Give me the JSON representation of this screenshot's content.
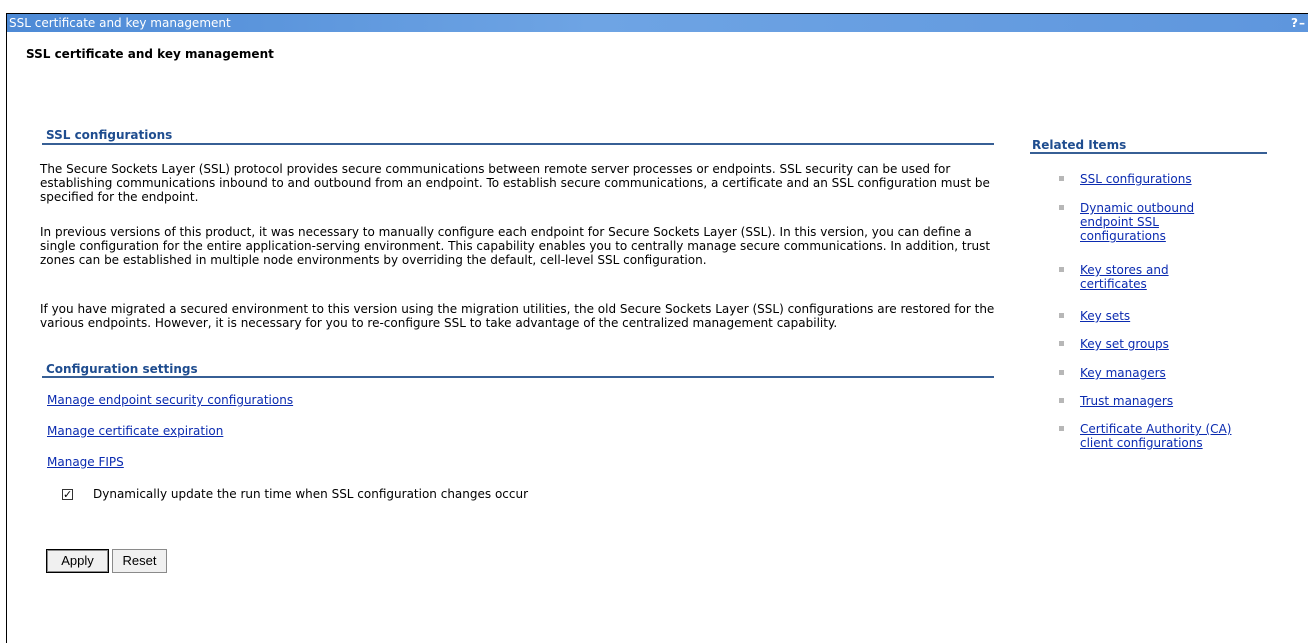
{
  "window": {
    "title": "SSL certificate and key management",
    "help_glyph": "?",
    "minimize_glyph": "–"
  },
  "page": {
    "title": "SSL certificate and key management"
  },
  "ssl_configurations": {
    "heading": "SSL configurations",
    "paragraphs": [
      "The Secure Sockets Layer (SSL) protocol provides secure communications between remote server processes or endpoints. SSL security can be used for establishing communications inbound to and outbound from an endpoint. To establish secure communications, a certificate and an SSL configuration must be specified for the endpoint.",
      "In previous versions of this product, it was necessary to manually configure each endpoint for Secure Sockets Layer (SSL). In this version, you can define a single configuration for the entire application-serving environment. This capability enables you to centrally manage secure communications. In addition, trust zones can be established in multiple node environments by overriding the default, cell-level SSL configuration.",
      "If you have migrated a secured environment to this version using the migration utilities, the old Secure Sockets Layer (SSL) configurations are restored for the various endpoints. However, it is necessary for you to re-configure SSL to take advantage of the centralized management capability."
    ]
  },
  "configuration_settings": {
    "heading": "Configuration settings",
    "links": [
      "Manage endpoint security configurations",
      "Manage certificate expiration",
      "Manage FIPS"
    ],
    "checkbox": {
      "label": "Dynamically update the run time when SSL configuration changes occur",
      "checked": true
    }
  },
  "buttons": {
    "apply": "Apply",
    "reset": "Reset"
  },
  "related_items": {
    "heading": "Related Items",
    "items": [
      "SSL configurations",
      "Dynamic outbound endpoint SSL configurations",
      "Key stores and certificates",
      "Key sets",
      "Key set groups",
      "Key managers",
      "Trust managers",
      "Certificate Authority (CA) client configurations"
    ]
  }
}
